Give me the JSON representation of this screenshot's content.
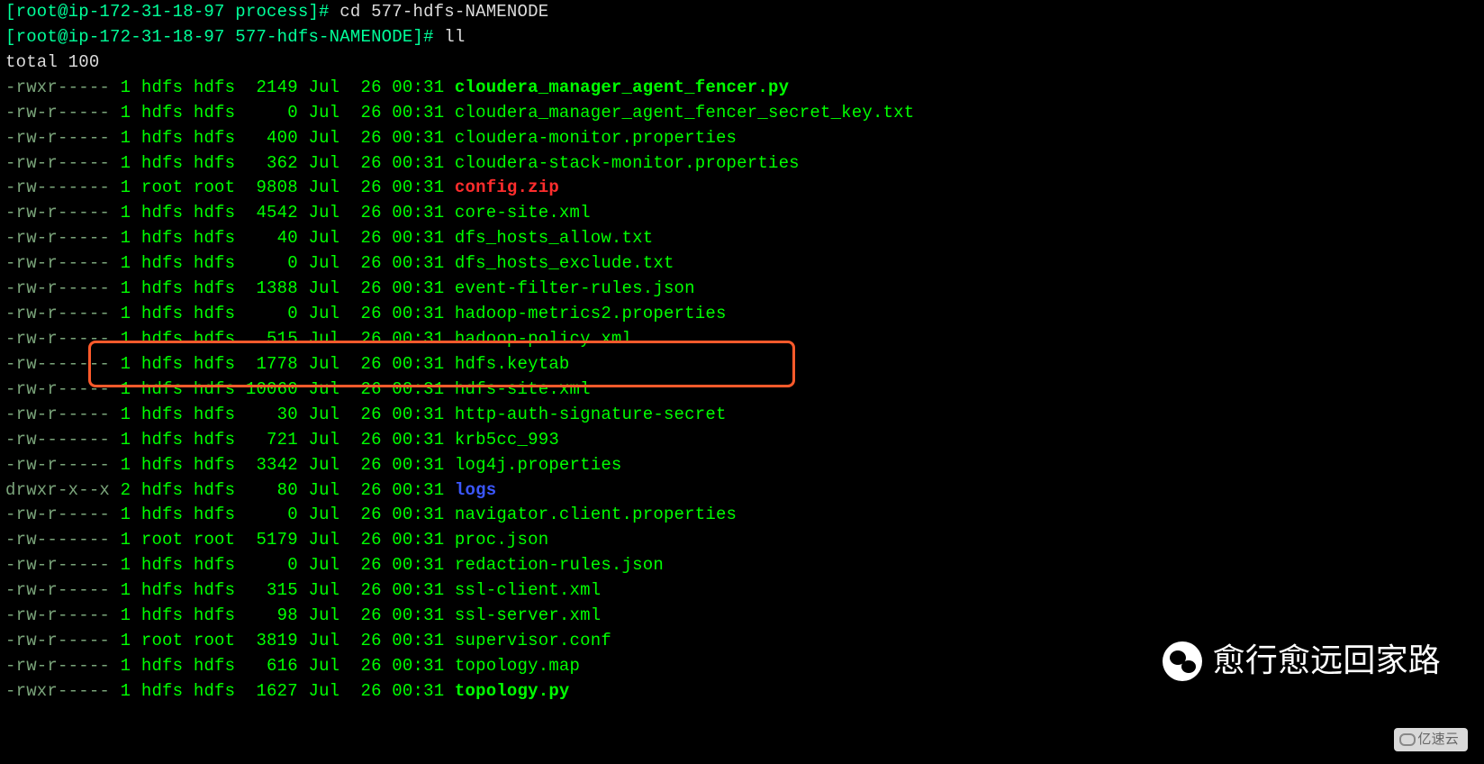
{
  "prompts": [
    {
      "user": "root",
      "host": "ip-172-31-18-97",
      "cwd": "process",
      "cmd": "cd 577-hdfs-NAMENODE"
    },
    {
      "user": "root",
      "host": "ip-172-31-18-97",
      "cwd": "577-hdfs-NAMENODE",
      "cmd": "ll"
    }
  ],
  "total_line": "total 100",
  "date": "Jul  26 00:31",
  "rows": [
    {
      "perm": "-rwxr-----",
      "links": "1",
      "owner": "hdfs",
      "group": "hdfs",
      "size": "2149",
      "name": "cloudera_manager_agent_fencer.py",
      "style": "bold-g"
    },
    {
      "perm": "-rw-r-----",
      "links": "1",
      "owner": "hdfs",
      "group": "hdfs",
      "size": "0",
      "name": "cloudera_manager_agent_fencer_secret_key.txt",
      "style": ""
    },
    {
      "perm": "-rw-r-----",
      "links": "1",
      "owner": "hdfs",
      "group": "hdfs",
      "size": "400",
      "name": "cloudera-monitor.properties",
      "style": ""
    },
    {
      "perm": "-rw-r-----",
      "links": "1",
      "owner": "hdfs",
      "group": "hdfs",
      "size": "362",
      "name": "cloudera-stack-monitor.properties",
      "style": ""
    },
    {
      "perm": "-rw-------",
      "links": "1",
      "owner": "root",
      "group": "root",
      "size": "9808",
      "name": "config.zip",
      "style": "red-b"
    },
    {
      "perm": "-rw-r-----",
      "links": "1",
      "owner": "hdfs",
      "group": "hdfs",
      "size": "4542",
      "name": "core-site.xml",
      "style": ""
    },
    {
      "perm": "-rw-r-----",
      "links": "1",
      "owner": "hdfs",
      "group": "hdfs",
      "size": "40",
      "name": "dfs_hosts_allow.txt",
      "style": ""
    },
    {
      "perm": "-rw-r-----",
      "links": "1",
      "owner": "hdfs",
      "group": "hdfs",
      "size": "0",
      "name": "dfs_hosts_exclude.txt",
      "style": ""
    },
    {
      "perm": "-rw-r-----",
      "links": "1",
      "owner": "hdfs",
      "group": "hdfs",
      "size": "1388",
      "name": "event-filter-rules.json",
      "style": ""
    },
    {
      "perm": "-rw-r-----",
      "links": "1",
      "owner": "hdfs",
      "group": "hdfs",
      "size": "0",
      "name": "hadoop-metrics2.properties",
      "style": ""
    },
    {
      "perm": "-rw-r-----",
      "links": "1",
      "owner": "hdfs",
      "group": "hdfs",
      "size": "515",
      "name": "hadoop-policy.xml",
      "style": ""
    },
    {
      "perm": "-rw-------",
      "links": "1",
      "owner": "hdfs",
      "group": "hdfs",
      "size": "1778",
      "name": "hdfs.keytab",
      "style": ""
    },
    {
      "perm": "-rw-r-----",
      "links": "1",
      "owner": "hdfs",
      "group": "hdfs",
      "size": "10060",
      "name": "hdfs-site.xml",
      "style": ""
    },
    {
      "perm": "-rw-r-----",
      "links": "1",
      "owner": "hdfs",
      "group": "hdfs",
      "size": "30",
      "name": "http-auth-signature-secret",
      "style": ""
    },
    {
      "perm": "-rw-------",
      "links": "1",
      "owner": "hdfs",
      "group": "hdfs",
      "size": "721",
      "name": "krb5cc_993",
      "style": ""
    },
    {
      "perm": "-rw-r-----",
      "links": "1",
      "owner": "hdfs",
      "group": "hdfs",
      "size": "3342",
      "name": "log4j.properties",
      "style": ""
    },
    {
      "perm": "drwxr-x--x",
      "links": "2",
      "owner": "hdfs",
      "group": "hdfs",
      "size": "80",
      "name": "logs",
      "style": "blue-b"
    },
    {
      "perm": "-rw-r-----",
      "links": "1",
      "owner": "hdfs",
      "group": "hdfs",
      "size": "0",
      "name": "navigator.client.properties",
      "style": ""
    },
    {
      "perm": "-rw-------",
      "links": "1",
      "owner": "root",
      "group": "root",
      "size": "5179",
      "name": "proc.json",
      "style": ""
    },
    {
      "perm": "-rw-r-----",
      "links": "1",
      "owner": "hdfs",
      "group": "hdfs",
      "size": "0",
      "name": "redaction-rules.json",
      "style": ""
    },
    {
      "perm": "-rw-r-----",
      "links": "1",
      "owner": "hdfs",
      "group": "hdfs",
      "size": "315",
      "name": "ssl-client.xml",
      "style": ""
    },
    {
      "perm": "-rw-r-----",
      "links": "1",
      "owner": "hdfs",
      "group": "hdfs",
      "size": "98",
      "name": "ssl-server.xml",
      "style": ""
    },
    {
      "perm": "-rw-r-----",
      "links": "1",
      "owner": "root",
      "group": "root",
      "size": "3819",
      "name": "supervisor.conf",
      "style": ""
    },
    {
      "perm": "-rw-r-----",
      "links": "1",
      "owner": "hdfs",
      "group": "hdfs",
      "size": "616",
      "name": "topology.map",
      "style": ""
    },
    {
      "perm": "-rwxr-----",
      "links": "1",
      "owner": "hdfs",
      "group": "hdfs",
      "size": "1627",
      "name": "topology.py",
      "style": "bold-g"
    }
  ],
  "highlight_index": 11,
  "watermarks": {
    "wechat_text": "愈行愈远回家路",
    "footer_text": "亿速云"
  }
}
